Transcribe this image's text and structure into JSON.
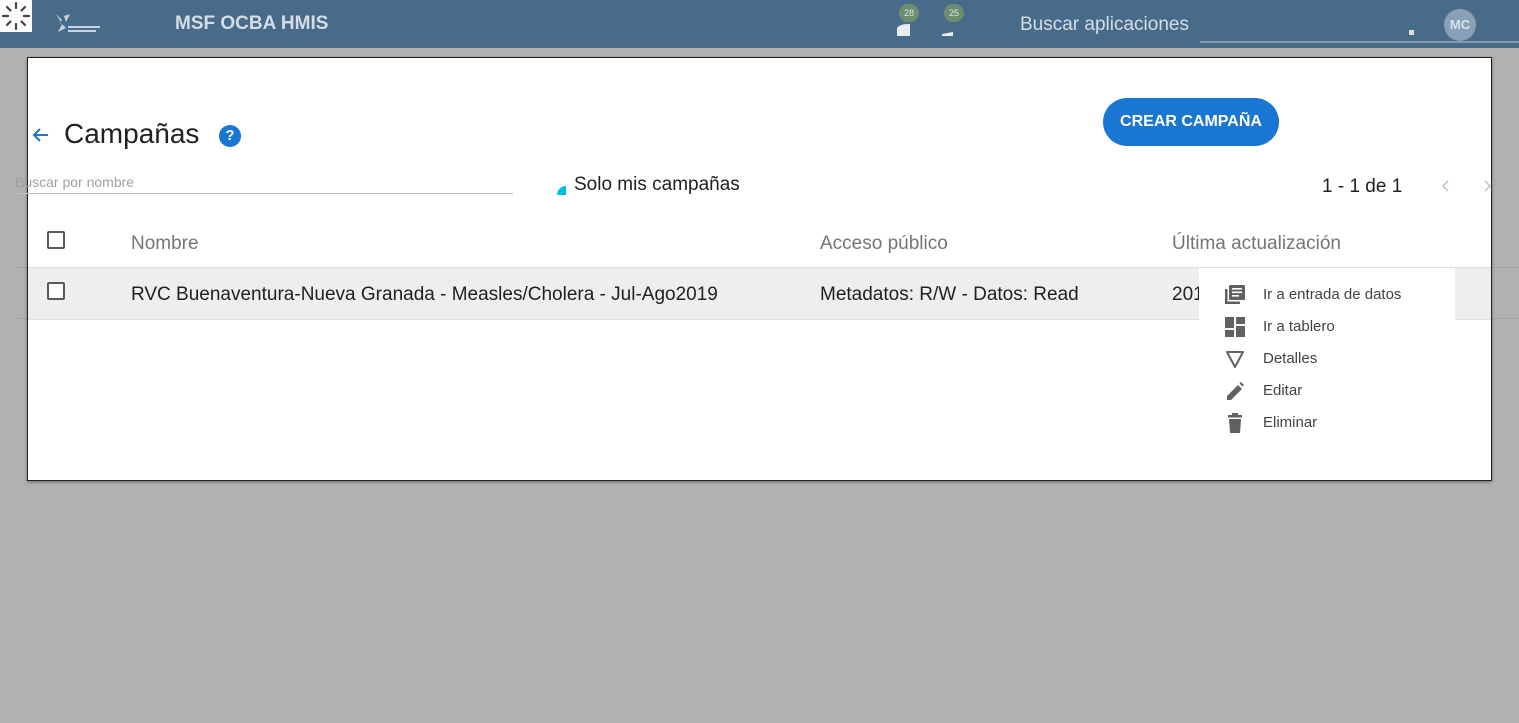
{
  "header": {
    "app_title": "MSF OCBA HMIS",
    "messages_badge": "28",
    "interpretations_badge": "25",
    "search_apps_label": "Buscar aplicaciones",
    "avatar_initials": "MC"
  },
  "page": {
    "title": "Campañas",
    "help_symbol": "?",
    "create_button": "CREAR CAMPAÑA",
    "search_placeholder": "Buscar por nombre",
    "only_mine_label": "Solo mis campañas",
    "pagination": "1 - 1 de 1"
  },
  "table": {
    "columns": [
      "Nombre",
      "Acceso público",
      "Última actualización"
    ],
    "rows": [
      {
        "name": "RVC Buenaventura-Nueva Granada - Measles/Cholera - Jul-Ago2019",
        "public_access": "Metadatos: R/W - Datos: Read",
        "last_updated": "201"
      }
    ]
  },
  "context_menu": [
    {
      "label": "Ir a entrada de datos",
      "icon": "data-entry-icon"
    },
    {
      "label": "Ir a tablero",
      "icon": "dashboard-icon"
    },
    {
      "label": "Detalles",
      "icon": "details-icon"
    },
    {
      "label": "Editar",
      "icon": "edit-icon"
    },
    {
      "label": "Eliminar",
      "icon": "delete-icon"
    }
  ],
  "colors": {
    "header_bg": "#486b8a",
    "primary": "#1976d2",
    "toggle_accent": "#00bcd4",
    "overlay_bg": "#b1b1b1"
  }
}
